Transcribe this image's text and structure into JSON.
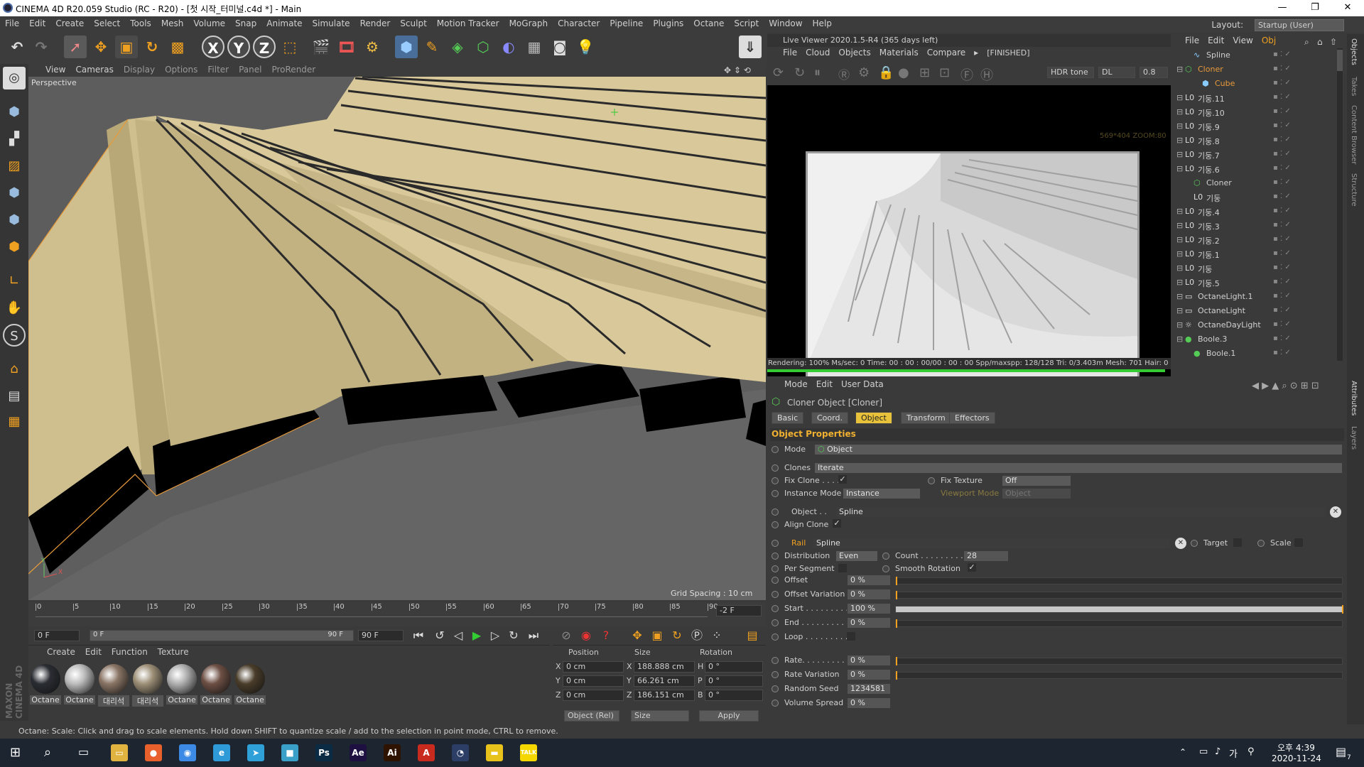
{
  "window": {
    "title": "CINEMA 4D R20.059 Studio (RC - R20) - [첫 시작_터미널.c4d *] - Main",
    "min_glyph": "—",
    "max_glyph": "❐",
    "close_glyph": "✕"
  },
  "menubar": {
    "items": [
      "File",
      "Edit",
      "Create",
      "Select",
      "Tools",
      "Mesh",
      "Volume",
      "Snap",
      "Animate",
      "Simulate",
      "Render",
      "Sculpt",
      "Motion Tracker",
      "MoGraph",
      "Character",
      "Pipeline",
      "Plugins",
      "Octane",
      "Script",
      "Window",
      "Help"
    ],
    "layout_label": "Layout:",
    "layout_value": "Startup (User)"
  },
  "toolbar": {
    "buttons": [
      "undo-icon",
      "redo-icon",
      "select-icon",
      "move-icon",
      "scale-icon",
      "rotate-icon",
      "scale2-icon",
      "x-axis-icon",
      "y-axis-icon",
      "z-axis-icon",
      "coord-icon",
      "render-view-icon",
      "render-picture-icon",
      "edit-render-icon",
      "cube-icon",
      "pen-icon",
      "subdivision-icon",
      "cloner-icon",
      "deformer-icon",
      "floor-icon",
      "camera-icon",
      "light-icon"
    ],
    "axis_labels": [
      "X",
      "Y",
      "Z"
    ]
  },
  "viewport": {
    "menu": [
      "View",
      "Cameras",
      "Display",
      "Options",
      "Filter",
      "Panel",
      "ProRender"
    ],
    "label": "Perspective",
    "grid_spacing": "Grid Spacing : 10 cm"
  },
  "timeline": {
    "ticks": [
      "0",
      "5",
      "10",
      "15",
      "20",
      "25",
      "30",
      "35",
      "40",
      "45",
      "50",
      "55",
      "60",
      "65",
      "70",
      "75",
      "80",
      "85",
      "90"
    ],
    "current_frame": "-2 F",
    "start_field": "0 F",
    "range_start": "0 F",
    "range_end": "90 F",
    "end_field": "90 F"
  },
  "materials": {
    "menu": [
      "Create",
      "Edit",
      "Function",
      "Texture"
    ],
    "items": [
      {
        "label": "Octane",
        "color": "#2a2d33"
      },
      {
        "label": "Octane",
        "color": "#bdbdbd"
      },
      {
        "label": "대리석",
        "color": "#8a7565"
      },
      {
        "label": "대리석",
        "color": "#9e9078"
      },
      {
        "label": "Octane",
        "color": "#b0b0b0"
      },
      {
        "label": "Octane",
        "color": "#6d4f44"
      },
      {
        "label": "Octane",
        "color": "#4a3d2a"
      }
    ]
  },
  "coords": {
    "headers": [
      "Position",
      "Size",
      "Rotation"
    ],
    "rows": [
      {
        "axis": "X",
        "pos": "0 cm",
        "saxis": "X",
        "size": "188.888 cm",
        "raxis": "H",
        "rot": "0 °"
      },
      {
        "axis": "Y",
        "pos": "0 cm",
        "saxis": "Y",
        "size": "66.261 cm",
        "raxis": "P",
        "rot": "0 °"
      },
      {
        "axis": "Z",
        "pos": "0 cm",
        "saxis": "Z",
        "size": "186.151 cm",
        "raxis": "B",
        "rot": "0 °"
      }
    ],
    "mode": "Object (Rel)",
    "size_mode": "Size",
    "apply": "Apply"
  },
  "status": "Octane:    Scale: Click and drag to scale elements. Hold down SHIFT to quantize scale / add to the selection in point mode, CTRL to remove.",
  "liveviewer": {
    "title": "Live Viewer 2020.1.5-R4 (365 days left)",
    "menu": [
      "File",
      "Cloud",
      "Objects",
      "Materials",
      "Compare"
    ],
    "finished": "[FINISHED]",
    "tone": "HDR tone",
    "kernel": "DL",
    "value": "0.8",
    "zoom_text": "569*404 ZOOM:80",
    "status": "Rendering: 100% Ms/sec: 0    Time: 00 : 00 : 00/00 : 00 : 00    Spp/maxspp: 128/128    Tri: 0/3.403m    Mesh: 701    Hair: 0    RTX:"
  },
  "objects": {
    "menu": [
      "File",
      "Edit",
      "View",
      "Obj"
    ],
    "rows": [
      {
        "name": "Spline",
        "indent": 1,
        "color": "#d0d0d0",
        "icon": "spline-icon"
      },
      {
        "name": "Cloner",
        "indent": 0,
        "color": "#e69a3a",
        "icon": "cloner-icon"
      },
      {
        "name": "Cube",
        "indent": 2,
        "color": "#e69a3a",
        "icon": "cube-icon"
      },
      {
        "name": "기둥.11",
        "indent": 0,
        "color": "#d0d0d0",
        "icon": "null-icon"
      },
      {
        "name": "기둥.10",
        "indent": 0,
        "color": "#d0d0d0",
        "icon": "null-icon"
      },
      {
        "name": "기둥.9",
        "indent": 0,
        "color": "#d0d0d0",
        "icon": "null-icon"
      },
      {
        "name": "기둥.8",
        "indent": 0,
        "color": "#d0d0d0",
        "icon": "null-icon"
      },
      {
        "name": "기둥.7",
        "indent": 0,
        "color": "#d0d0d0",
        "icon": "null-icon"
      },
      {
        "name": "기둥.6",
        "indent": 0,
        "color": "#d0d0d0",
        "icon": "null-icon"
      },
      {
        "name": "Cloner",
        "indent": 1,
        "color": "#d0d0d0",
        "icon": "cloner-icon"
      },
      {
        "name": "기둥",
        "indent": 1,
        "color": "#d0d0d0",
        "icon": "null-icon"
      },
      {
        "name": "기둥.4",
        "indent": 0,
        "color": "#d0d0d0",
        "icon": "null-icon"
      },
      {
        "name": "기둥.3",
        "indent": 0,
        "color": "#d0d0d0",
        "icon": "null-icon"
      },
      {
        "name": "기둥.2",
        "indent": 0,
        "color": "#d0d0d0",
        "icon": "null-icon"
      },
      {
        "name": "기둥.1",
        "indent": 0,
        "color": "#d0d0d0",
        "icon": "null-icon"
      },
      {
        "name": "기둥",
        "indent": 0,
        "color": "#d0d0d0",
        "icon": "null-icon"
      },
      {
        "name": "기둥.5",
        "indent": 0,
        "color": "#d0d0d0",
        "icon": "null-icon"
      },
      {
        "name": "OctaneLight.1",
        "indent": 0,
        "color": "#d0d0d0",
        "icon": "light-icon"
      },
      {
        "name": "OctaneLight",
        "indent": 0,
        "color": "#d0d0d0",
        "icon": "light-icon"
      },
      {
        "name": "OctaneDayLight",
        "indent": 0,
        "color": "#d0d0d0",
        "icon": "daylight-icon"
      },
      {
        "name": "Boole.3",
        "indent": 0,
        "color": "#d0d0d0",
        "icon": "boole-icon"
      },
      {
        "name": "Boole.1",
        "indent": 1,
        "color": "#d0d0d0",
        "icon": "boole-icon"
      }
    ]
  },
  "sidetabs": [
    "Objects",
    "Takes",
    "Content Browser",
    "Structure",
    "Attributes",
    "Layers"
  ],
  "attributes": {
    "menu": [
      "Mode",
      "Edit",
      "User Data"
    ],
    "object_title": "Cloner Object [Cloner]",
    "tabs": [
      "Basic",
      "Coord.",
      "Object",
      "Transform",
      "Effectors"
    ],
    "active_tab": "Object",
    "section": "Object Properties",
    "mode_label": "Mode",
    "mode_value": "Object",
    "clones_label": "Clones",
    "clones_value": "Iterate",
    "fix_clone": "Fix Clone . . . . .",
    "fix_texture": "Fix Texture",
    "fix_texture_value": "Off",
    "instance_mode": "Instance Mode",
    "instance_value": "Instance",
    "viewport_mode": "Viewport Mode",
    "viewport_value": "Object",
    "object_label": "Object . .",
    "object_value": "Spline",
    "align_clone": "Align Clone",
    "rail_label": "Rail",
    "rail_value": "Spline",
    "target_label": "Target",
    "scale_label": "Scale",
    "distribution_label": "Distribution",
    "distribution_value": "Even",
    "count_label": "Count . . . . . . . . .",
    "count_value": "28",
    "per_segment": "Per Segment",
    "smooth_rotation": "Smooth Rotation",
    "sliders": [
      {
        "label": "Offset",
        "value": "0 %",
        "fill": 0
      },
      {
        "label": "Offset Variation",
        "value": "0 %",
        "fill": 0
      },
      {
        "label": "Start . . . . . . . . .",
        "value": "100 %",
        "fill": 1.0
      },
      {
        "label": "End . . . . . . . . . .",
        "value": "0 %",
        "fill": 0
      }
    ],
    "loop_label": "Loop . . . . . . . . .",
    "rate_sliders": [
      {
        "label": "Rate. . . . . . . . . .",
        "value": "0 %",
        "fill": 0
      },
      {
        "label": "Rate Variation",
        "value": "0 %",
        "fill": 0
      }
    ],
    "random_seed_label": "Random Seed",
    "random_seed_value": "1234581",
    "volume_spread_label": "Volume Spread",
    "volume_spread_value": "0 %"
  },
  "taskbar": {
    "time": "오후 4:39",
    "date": "2020-11-24",
    "notif": "7",
    "apps": [
      {
        "name": "file-explorer-icon",
        "glyph": "▭",
        "color": "#e0b341"
      },
      {
        "name": "firefox-icon",
        "glyph": "●",
        "color": "#e8602c"
      },
      {
        "name": "chrome-icon",
        "glyph": "◉",
        "color": "#3d8ae6"
      },
      {
        "name": "edge-icon",
        "glyph": "e",
        "color": "#2f9ad8"
      },
      {
        "name": "app-blue-icon",
        "glyph": "➤",
        "color": "#2fa0d8"
      },
      {
        "name": "app-cyan-icon",
        "glyph": "■",
        "color": "#3aa0c8"
      },
      {
        "name": "photoshop-icon",
        "glyph": "Ps",
        "color": "#0b2a44"
      },
      {
        "name": "after-effects-icon",
        "glyph": "Ae",
        "color": "#1e1040"
      },
      {
        "name": "illustrator-icon",
        "glyph": "Ai",
        "color": "#2e1400"
      },
      {
        "name": "acrobat-icon",
        "glyph": "A",
        "color": "#c82a1e"
      },
      {
        "name": "cinema4d-icon",
        "glyph": "◔",
        "color": "#2c3e66"
      },
      {
        "name": "sticky-notes-icon",
        "glyph": "▬",
        "color": "#e6c21a"
      },
      {
        "name": "kakaotalk-icon",
        "glyph": "TALK",
        "color": "#f5d700"
      }
    ]
  }
}
